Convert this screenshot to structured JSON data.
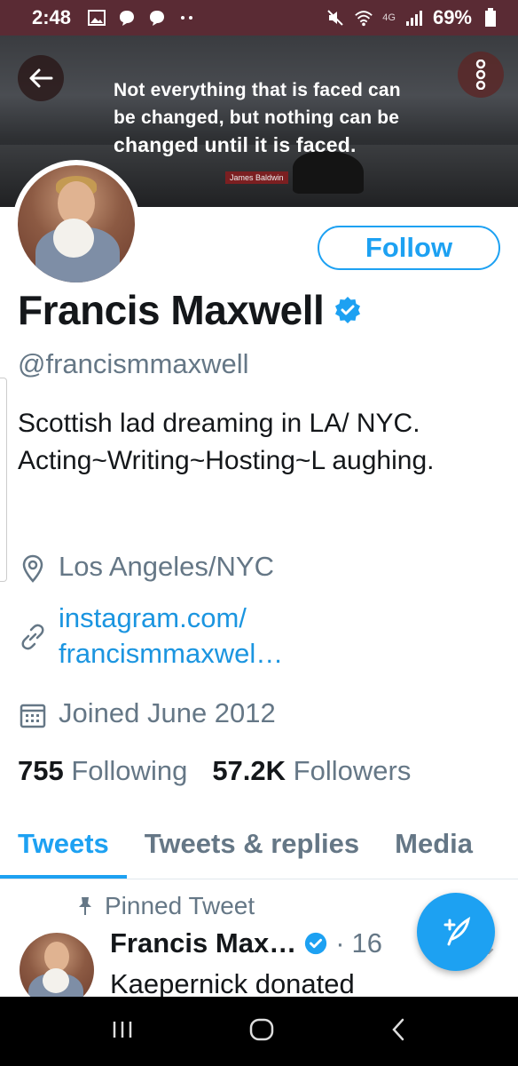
{
  "status_bar": {
    "time": "2:48",
    "signal_label": "4G",
    "battery": "69%",
    "icons": [
      "image-icon",
      "chat-icon",
      "chat-icon",
      "more-dots-icon",
      "mute-icon",
      "wifi-icon",
      "signal-icon",
      "battery-icon"
    ]
  },
  "banner": {
    "quote_line1": "Not everything that is faced can",
    "quote_line2": "be changed, but nothing can be",
    "quote_line3": "changed until it is faced.",
    "author": "James Baldwin"
  },
  "profile": {
    "follow_label": "Follow",
    "name": "Francis Maxwell",
    "handle": "@francismmaxwell",
    "bio": "Scottish lad dreaming in LA/ NYC. Acting~Writing~Hosting~L aughing.",
    "location": "Los Angeles/NYC",
    "link_line1": "instagram.com/",
    "link_line2": "francismmaxwel…",
    "joined": "Joined June 2012",
    "following_count": "755",
    "following_label": "Following",
    "followers_count": "57.2K",
    "followers_label": "Followers"
  },
  "tabs": [
    {
      "label": "Tweets",
      "active": true
    },
    {
      "label": "Tweets & replies",
      "active": false
    },
    {
      "label": "Media",
      "active": false
    }
  ],
  "pinned_tweet": {
    "pinned_label": "Pinned Tweet",
    "author": "Francis Max…",
    "separator": "·",
    "time": "16",
    "text": "Kaepernick donated"
  },
  "colors": {
    "accent": "#1da1f2",
    "status_bar": "#5a2b34",
    "secondary_text": "#657786"
  }
}
